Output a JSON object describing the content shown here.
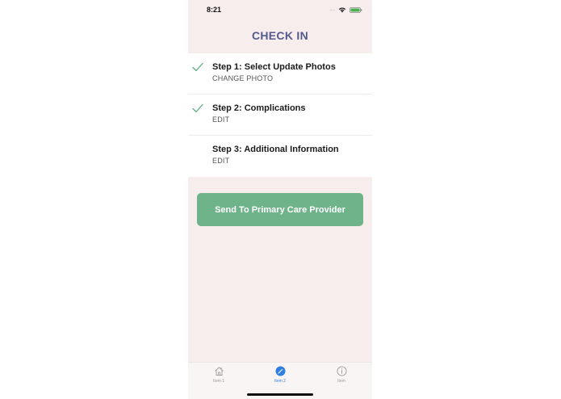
{
  "status_bar": {
    "time": "8:21",
    "signal": "....",
    "battery_color": "#4caf50"
  },
  "header": {
    "title": "CHECK IN"
  },
  "steps": [
    {
      "title": "Step 1: Select Update Photos",
      "action": "CHANGE PHOTO",
      "completed": true
    },
    {
      "title": "Step 2: Complications",
      "action": "EDIT",
      "completed": true
    },
    {
      "title": "Step 3: Additional Information",
      "action": "EDIT",
      "completed": false
    }
  ],
  "send_button": {
    "label": "Send To Primary Care Provider",
    "color": "#6eb38a"
  },
  "tab_bar": {
    "items": [
      {
        "label": "Item 1",
        "icon": "home-icon",
        "active": false
      },
      {
        "label": "Item 2",
        "icon": "compose-icon",
        "active": true
      },
      {
        "label": "Item",
        "icon": "info-icon",
        "active": false
      }
    ]
  },
  "colors": {
    "background": "#f7eded",
    "title": "#555a8e",
    "check": "#5fae7e",
    "active_tab": "#2f7fe0"
  }
}
